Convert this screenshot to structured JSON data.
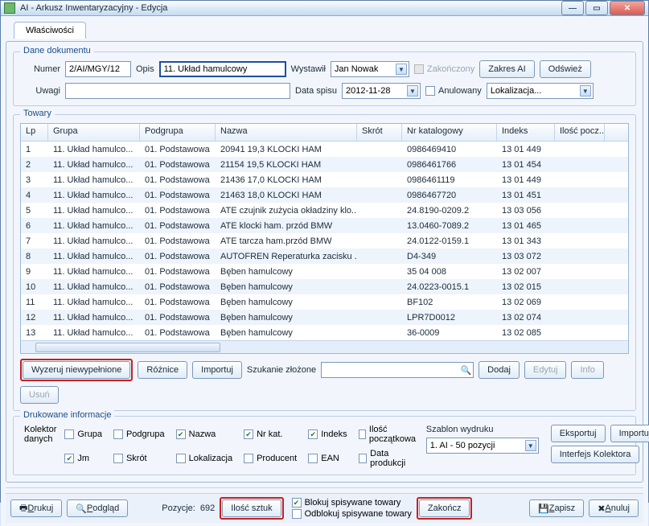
{
  "title": "AI - Arkusz Inwentaryzacyjny - Edycja",
  "tab": "Właściwości",
  "doc": {
    "legend": "Dane dokumentu",
    "lbl_numer": "Numer",
    "numer": "2/AI/MGY/12",
    "lbl_opis": "Opis",
    "opis": "11. Układ hamulcowy",
    "lbl_wystawil": "Wystawił",
    "wystawil": "Jan Nowak",
    "chk_zakonczony": "Zakończony",
    "btn_zakres": "Zakres AI",
    "btn_odswiez": "Odśwież",
    "lbl_uwagi": "Uwagi",
    "uwagi": "",
    "lbl_data": "Data spisu",
    "data": "2012-11-28",
    "chk_anulowany": "Anulowany",
    "lokalizacja": "Lokalizacja..."
  },
  "goods": {
    "legend": "Towary",
    "cols": [
      "Lp",
      "Grupa",
      "Podgrupa",
      "Nazwa",
      "Skrót",
      "Nr katalogowy",
      "Indeks",
      "Ilość pocz..."
    ],
    "rows": [
      [
        "1",
        "11. Układ hamulco...",
        "01. Podstawowa",
        "20941 19,3 KLOCKI HAM",
        "",
        "0986469410",
        "13 01 449",
        ""
      ],
      [
        "2",
        "11. Układ hamulco...",
        "01. Podstawowa",
        "21154 19,5 KLOCKI HAM",
        "",
        "0986461766",
        "13 01 454",
        ""
      ],
      [
        "3",
        "11. Układ hamulco...",
        "01. Podstawowa",
        "21436 17,0 KLOCKI HAM",
        "",
        "0986461119",
        "13 01 449",
        ""
      ],
      [
        "4",
        "11. Układ hamulco...",
        "01. Podstawowa",
        "21463 18,0 KLOCKI HAM",
        "",
        "0986467720",
        "13 01 451",
        ""
      ],
      [
        "5",
        "11. Układ hamulco...",
        "01. Podstawowa",
        "ATE czujnik zużycia okładziny klo...",
        "",
        "24.8190-0209.2",
        "13 03 056",
        ""
      ],
      [
        "6",
        "11. Układ hamulco...",
        "01. Podstawowa",
        "ATE klocki ham. przód BMW",
        "",
        "13.0460-7089.2",
        "13 01 465",
        ""
      ],
      [
        "7",
        "11. Układ hamulco...",
        "01. Podstawowa",
        "ATE tarcza ham.przód BMW",
        "",
        "24.0122-0159.1",
        "13 01 343",
        ""
      ],
      [
        "8",
        "11. Układ hamulco...",
        "01. Podstawowa",
        "AUTOFREN Reperaturka zacisku ...",
        "",
        "D4-349",
        "13 03 072",
        ""
      ],
      [
        "9",
        "11. Układ hamulco...",
        "01. Podstawowa",
        "Bęben hamulcowy",
        "",
        "35 04  008",
        "13 02 007",
        ""
      ],
      [
        "10",
        "11. Układ hamulco...",
        "01. Podstawowa",
        "Bęben hamulcowy",
        "",
        "24.0223-0015.1",
        "13 02 015",
        ""
      ],
      [
        "11",
        "11. Układ hamulco...",
        "01. Podstawowa",
        "Bęben hamulcowy",
        "",
        "BF102",
        "13 02 069",
        ""
      ],
      [
        "12",
        "11. Układ hamulco...",
        "01. Podstawowa",
        "Bęben hamulcowy",
        "",
        "LPR7D0012",
        "13 02 074",
        ""
      ],
      [
        "13",
        "11. Układ hamulco...",
        "01. Podstawowa",
        "Bęben hamulcowy",
        "",
        "36-0009",
        "13 02 085",
        ""
      ]
    ]
  },
  "tb": {
    "wyzeruj": "Wyzeruj niewypełnione",
    "roznice": "Różnice",
    "importuj": "Importuj",
    "szukanie": "Szukanie złożone",
    "dodaj": "Dodaj",
    "edytuj": "Edytuj",
    "info": "Info",
    "usun": "Usuń"
  },
  "print": {
    "legend": "Drukowane informacje",
    "grupa": "Grupa",
    "podgrupa": "Podgrupa",
    "nazwa": "Nazwa",
    "nrkat": "Nr kat.",
    "indeks": "Indeks",
    "ilosc": "Ilość początkowa",
    "jm": "Jm",
    "skrot": "Skrót",
    "lokal": "Lokalizacja",
    "prod": "Producent",
    "ean": "EAN",
    "datap": "Data produkcji",
    "szablon_lbl": "Szablon wydruku",
    "szablon": "1. AI - 50 pozycji",
    "kol_legend": "Kolektor danych",
    "eksportuj": "Eksportuj",
    "importuj": "Importuj",
    "interfejs": "Interfejs Kolektora"
  },
  "foot": {
    "drukuj": "Drukuj",
    "podglad": "Podgląd",
    "pozycje_lbl": "Pozycje:",
    "pozycje": "692",
    "ilosc": "Ilość sztuk",
    "blokuj": "Blokuj spisywane towary",
    "odblokuj": "Odblokuj spisywane towary",
    "zakoncz": "Zakończ",
    "zapisz": "Zapisz",
    "anuluj": "Anuluj"
  }
}
